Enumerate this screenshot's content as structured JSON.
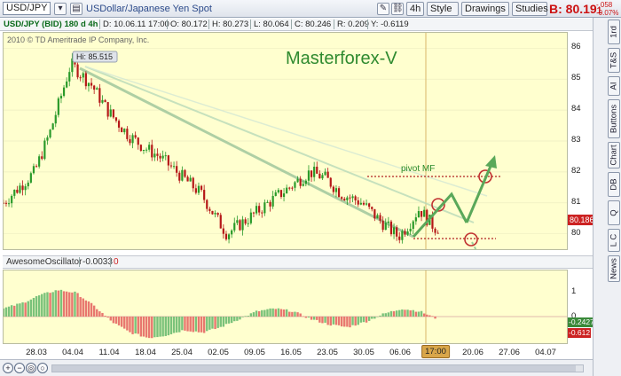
{
  "toolbar": {
    "symbol": "USD/JPY",
    "symbol_description": "USDollar/Japanese Yen Spot",
    "timeframe": "4h",
    "style_label": "Style",
    "drawings_label": "Drawings",
    "studies_label": "Studies",
    "bid_prefix": "B:",
    "price_main": "80.19",
    "price_small": "1",
    "change_1": "-.058",
    "change_2": "-0.07%"
  },
  "infobar": {
    "title": "USD/JPY (BID) 180 d 4h",
    "date": "D: 10.06.11 17:00",
    "open": "O: 80.172",
    "high": "H: 80.273",
    "low": "L: 80.064",
    "close": "C: 80.246",
    "range": "R: 0.209",
    "y": "Y: -0.6119"
  },
  "chart": {
    "copyright": "2010 © TD Ameritrade IP Company, Inc.",
    "watermark": "Masterforex-V",
    "hi_label": "Hi: 85.515",
    "pivot_label": "pivot MF",
    "last_price": "80.186",
    "price_ticks": [
      "86",
      "85",
      "84",
      "83",
      "82",
      "81",
      "80"
    ],
    "osc_ticks": [
      "1",
      "0"
    ],
    "osc_name": "AwesomeOscillator",
    "osc_value": "-0.0033",
    "osc_param": "0",
    "osc_tag_1": "-0.2427",
    "osc_tag_2": "-0.612",
    "time_ticks": [
      "28.03",
      "04.04",
      "11.04",
      "18.04",
      "25.04",
      "02.05",
      "09.05",
      "16.05",
      "23.05",
      "30.05",
      "06.06",
      "13.06",
      "20.06",
      "27.06",
      "04.07"
    ],
    "time_now": "17:00",
    "colors": {
      "up": "#2a9a2a",
      "down": "#b51818",
      "osc_up": "#7ac27a",
      "osc_down": "#e8776f",
      "panel": "#ffffcf"
    }
  },
  "chart_data": {
    "type": "candlestick",
    "symbol": "USD/JPY",
    "timeframe": "4h",
    "ylim": [
      79.5,
      86.5
    ],
    "high": 85.515,
    "last": 80.186,
    "x_ticks": [
      "28.03",
      "04.04",
      "11.04",
      "18.04",
      "25.04",
      "02.05",
      "09.05",
      "16.05",
      "23.05",
      "30.05",
      "06.06",
      "13.06",
      "20.06",
      "27.06",
      "04.07"
    ],
    "approx_path": [
      {
        "x": "22.03",
        "close": 81.0
      },
      {
        "x": "28.03",
        "close": 82.0
      },
      {
        "x": "31.03",
        "close": 83.3
      },
      {
        "x": "04.04",
        "close": 85.5
      },
      {
        "x": "08.04",
        "close": 84.8
      },
      {
        "x": "11.04",
        "close": 84.0
      },
      {
        "x": "15.04",
        "close": 83.2
      },
      {
        "x": "18.04",
        "close": 82.8
      },
      {
        "x": "21.04",
        "close": 82.5
      },
      {
        "x": "25.04",
        "close": 81.9
      },
      {
        "x": "29.04",
        "close": 81.3
      },
      {
        "x": "02.05",
        "close": 80.5
      },
      {
        "x": "04.05",
        "close": 80.0
      },
      {
        "x": "09.05",
        "close": 80.6
      },
      {
        "x": "12.05",
        "close": 81.0
      },
      {
        "x": "16.05",
        "close": 81.5
      },
      {
        "x": "20.05",
        "close": 82.0
      },
      {
        "x": "23.05",
        "close": 81.8
      },
      {
        "x": "26.05",
        "close": 81.3
      },
      {
        "x": "30.05",
        "close": 81.0
      },
      {
        "x": "02.06",
        "close": 80.5
      },
      {
        "x": "06.06",
        "close": 79.9
      },
      {
        "x": "08.06",
        "close": 80.3
      },
      {
        "x": "10.06",
        "close": 80.8
      },
      {
        "x": "13.06",
        "close": 80.2
      },
      {
        "x": "14.06",
        "close": 80.19
      }
    ],
    "oscillator": {
      "name": "AwesomeOscillator",
      "last": -0.0033,
      "approx_values": [
        0.3,
        0.5,
        0.8,
        1.0,
        0.9,
        0.4,
        -0.2,
        -0.6,
        -0.8,
        -0.7,
        -0.5,
        -0.6,
        -0.4,
        -0.1,
        0.2,
        0.3,
        0.2,
        -0.1,
        -0.3,
        -0.4,
        -0.2,
        0.1,
        0.3,
        0.2,
        -0.1
      ]
    }
  }
}
